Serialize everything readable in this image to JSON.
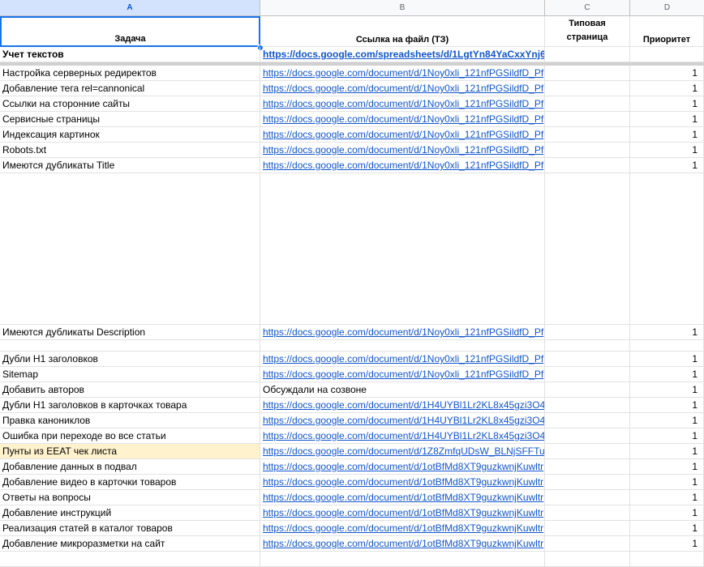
{
  "column_letters": [
    "A",
    "B",
    "C",
    "D"
  ],
  "headers": {
    "a": "Задача",
    "b": "Ссылка на файл (ТЗ)",
    "c": "Типовая страница",
    "d": "Приоритет"
  },
  "rows": [
    {
      "task": "Учет текстов",
      "link": "https://docs.google.com/spreadsheets/d/1LgtYn84YaCxxYnj6",
      "priority": "",
      "bold": true,
      "h": 19
    },
    {
      "task": "Настройка серверных редиректов",
      "link": "https://docs.google.com/document/d/1Noy0xli_121nfPGSildfD_Pf",
      "priority": "1",
      "h": 19
    },
    {
      "task": "Добавление тега rel=cannonical",
      "link": "https://docs.google.com/document/d/1Noy0xli_121nfPGSildfD_Pf",
      "priority": "1",
      "h": 19
    },
    {
      "task": "Ссылки на сторонние сайты",
      "link": "https://docs.google.com/document/d/1Noy0xli_121nfPGSildfD_Pf",
      "priority": "1",
      "h": 19
    },
    {
      "task": "Сервисные страницы",
      "link": "https://docs.google.com/document/d/1Noy0xli_121nfPGSildfD_Pf",
      "priority": "1",
      "h": 19
    },
    {
      "task": "Индексация картинок",
      "link": "https://docs.google.com/document/d/1Noy0xli_121nfPGSildfD_Pf",
      "priority": "1",
      "h": 19
    },
    {
      "task": "Robots.txt",
      "link": "https://docs.google.com/document/d/1Noy0xli_121nfPGSildfD_Pf",
      "priority": "1",
      "h": 19
    },
    {
      "task": "Имеются дубликаты Title",
      "link": "https://docs.google.com/document/d/1Noy0xli_121nfPGSildfD_Pf",
      "priority": "1",
      "h": 19,
      "top_align": true
    },
    {
      "task": "",
      "link": "",
      "priority": "",
      "h": 187
    },
    {
      "task": "Имеются дубликаты Description",
      "link": "https://docs.google.com/document/d/1Noy0xli_121nfPGSildfD_Pf",
      "priority": "1",
      "h": 19
    },
    {
      "task": "",
      "link": "",
      "priority": "",
      "h": 14
    },
    {
      "task": "Дубли H1 заголовков",
      "link": "https://docs.google.com/document/d/1Noy0xli_121nfPGSildfD_Pf",
      "priority": "1",
      "h": 19
    },
    {
      "task": "Sitemap",
      "link": "https://docs.google.com/document/d/1Noy0xli_121nfPGSildfD_Pf",
      "priority": "1",
      "h": 19
    },
    {
      "task": "Добавить авторов",
      "link": "Обсуждали на созвоне",
      "plain": true,
      "priority": "1",
      "h": 19
    },
    {
      "task": "Дубли H1 заголовков в карточках товара",
      "link": "https://docs.google.com/document/d/1H4UYBl1Lr2KL8x45gzi3O4",
      "priority": "1",
      "h": 19
    },
    {
      "task": "Правка канониклов",
      "link": "https://docs.google.com/document/d/1H4UYBl1Lr2KL8x45gzi3O4",
      "priority": "1",
      "h": 19
    },
    {
      "task": "Ошибка при переходе во все статьи",
      "link": "https://docs.google.com/document/d/1H4UYBl1Lr2KL8x45gzi3O4",
      "priority": "1",
      "h": 19
    },
    {
      "task": "Пунты из EEAT чек листа",
      "link": "https://docs.google.com/document/d/1Z8ZmfqUDsW_BLNjSFFTu",
      "priority": "1",
      "h": 19,
      "highlight": true
    },
    {
      "task": "Добавление данных в подвал",
      "link": "https://docs.google.com/document/d/1otBfMd8XT9guzkwnjKuwltr",
      "priority": "1",
      "h": 19
    },
    {
      "task": "Добавление видео в карточки товаров",
      "link": "https://docs.google.com/document/d/1otBfMd8XT9guzkwnjKuwltr",
      "priority": "1",
      "h": 19
    },
    {
      "task": "Ответы на вопросы",
      "link": "https://docs.google.com/document/d/1otBfMd8XT9guzkwnjKuwltr",
      "priority": "1",
      "h": 19
    },
    {
      "task": "Добавление инструкций",
      "link": "https://docs.google.com/document/d/1otBfMd8XT9guzkwnjKuwltr",
      "priority": "1",
      "h": 19
    },
    {
      "task": "Реализация статей в каталог товаров",
      "link": "https://docs.google.com/document/d/1otBfMd8XT9guzkwnjKuwltr",
      "priority": "1",
      "h": 19
    },
    {
      "task": "Добавление микроразметки на сайт",
      "link": "https://docs.google.com/document/d/1otBfMd8XT9guzkwnjKuwltr",
      "priority": "1",
      "h": 19
    },
    {
      "task": "",
      "link": "",
      "priority": "",
      "h": 19
    }
  ]
}
